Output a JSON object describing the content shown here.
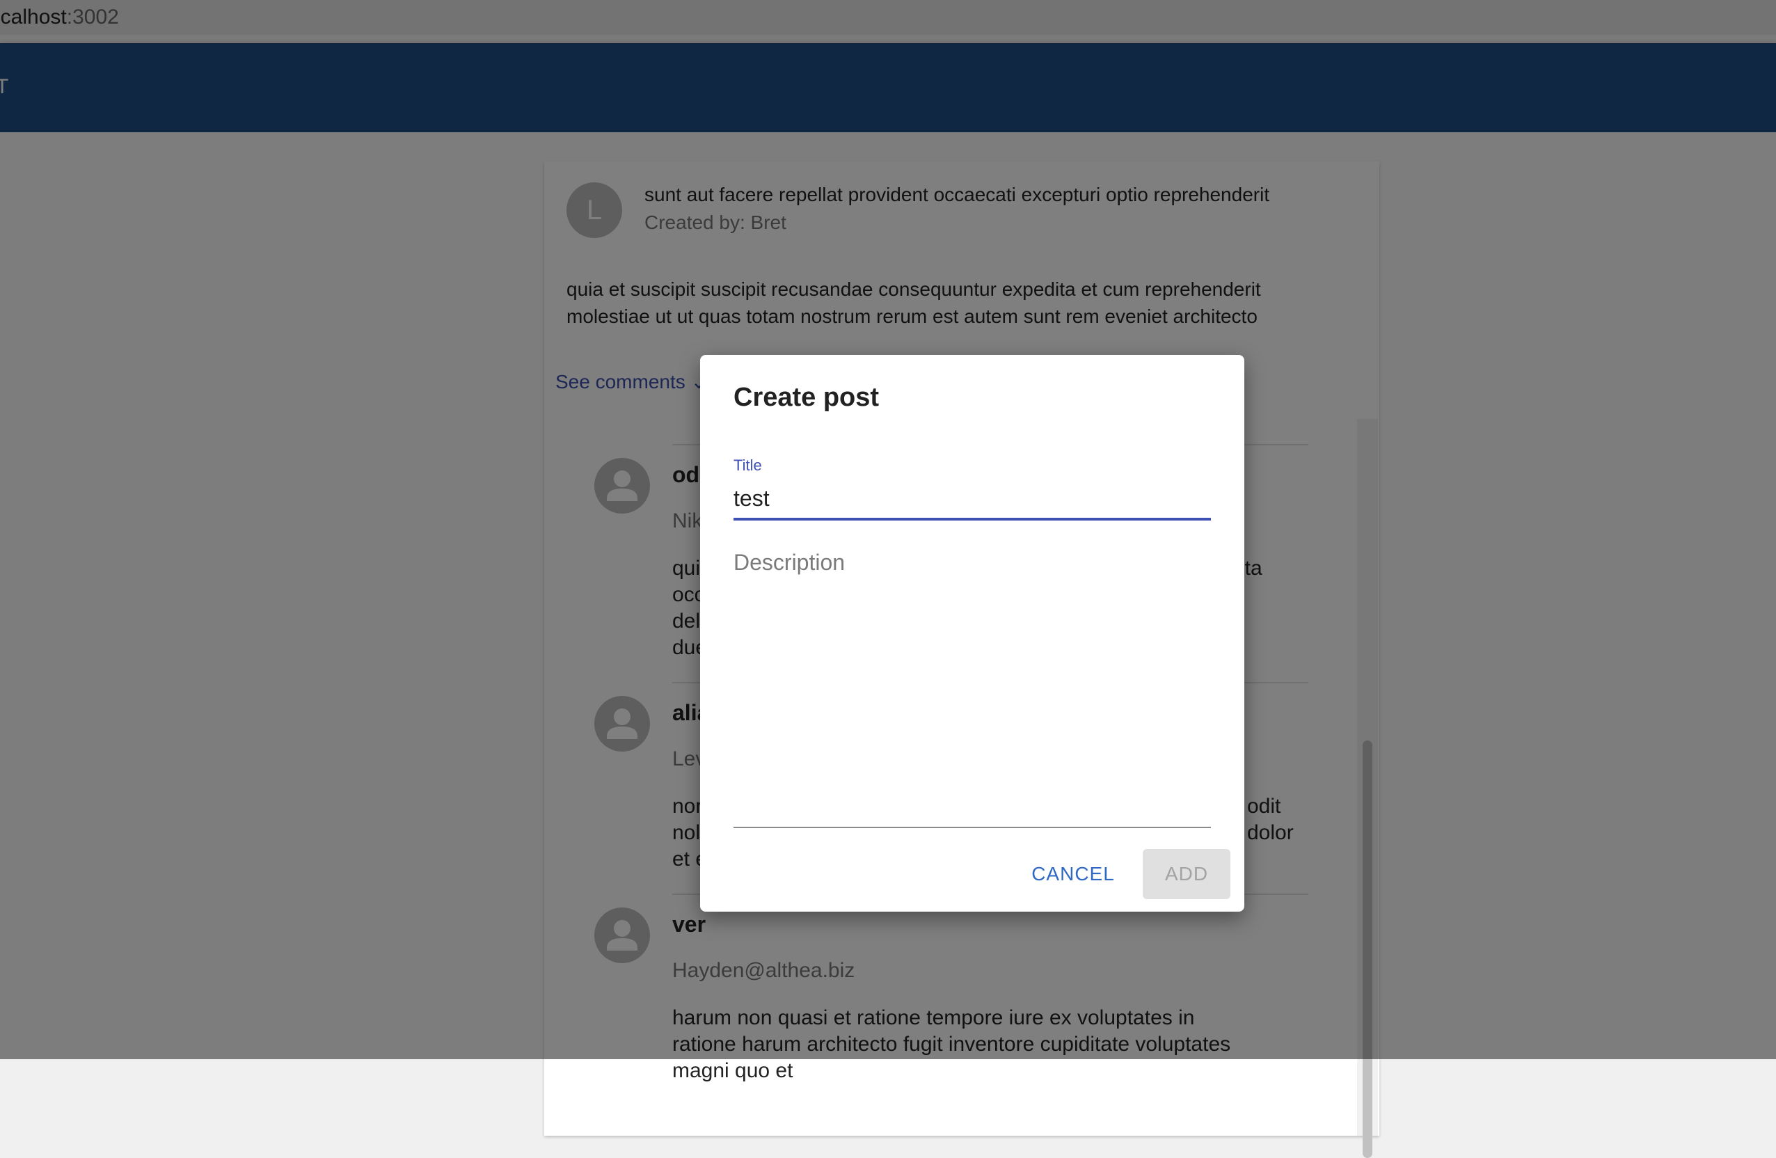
{
  "browser": {
    "url_host": "ocalhost",
    "url_port": ":3002"
  },
  "appbar": {
    "title": "T",
    "color": "#1f4e86"
  },
  "post": {
    "avatar_letter": "L",
    "title": "sunt aut facere repellat provident occaecati excepturi optio reprehenderit",
    "created_by": "Created by: Bret",
    "body_line1": "quia et suscipit suscipit recusandae consequuntur expedita et cum reprehenderit",
    "body_line2": "molestiae ut ut quas totam nostrum rerum est autem sunt rem eveniet architecto",
    "see_comments": "See comments"
  },
  "comments": [
    {
      "name": "od",
      "email": "Nik",
      "body_left": [
        "qui",
        "occ",
        "del",
        "due"
      ],
      "body_right": [
        "ita"
      ]
    },
    {
      "name": "alia",
      "email": "Lev",
      "body_left": [
        "nor",
        "nol",
        "et e"
      ],
      "body_right": [
        "odit",
        "dolor"
      ]
    },
    {
      "name": "ver",
      "email": "Hayden@althea.biz",
      "body": [
        "harum non quasi et ratione tempore iure ex voluptates in",
        "ratione harum architecto fugit inventore cupiditate voluptates",
        "magni quo et"
      ]
    }
  ],
  "dialog": {
    "title": "Create post",
    "title_label": "Title",
    "title_value": "test",
    "description_placeholder": "Description",
    "cancel_label": "CANCEL",
    "add_label": "ADD",
    "accent_color": "#3f51b5"
  }
}
